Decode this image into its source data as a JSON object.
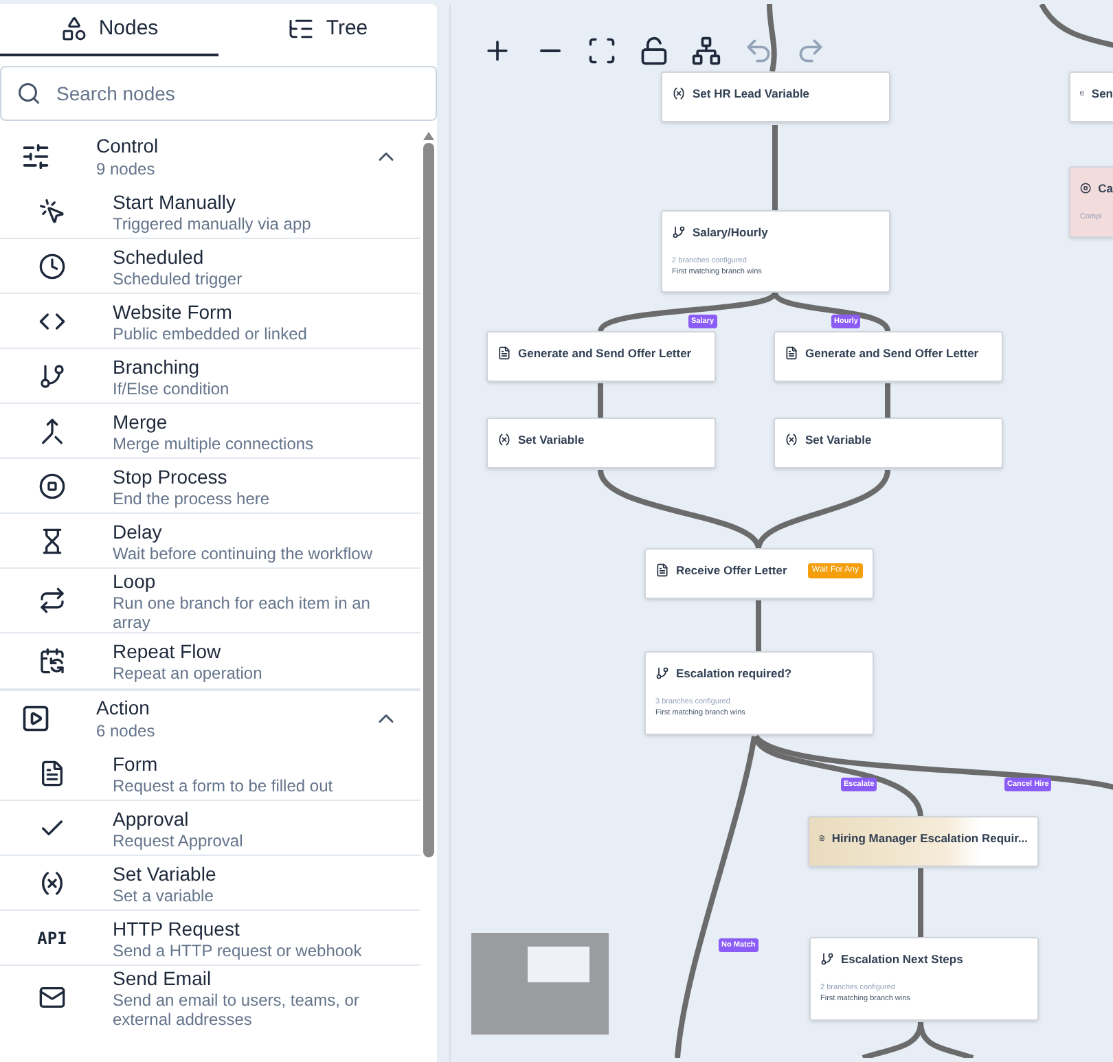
{
  "tabs": [
    {
      "label": "Nodes",
      "kind": "nodes",
      "selected": true
    },
    {
      "label": "Tree",
      "kind": "tree",
      "selected": false
    }
  ],
  "search": {
    "placeholder": "Search nodes"
  },
  "groups": [
    {
      "title": "Control",
      "kind": "control",
      "count": "9 nodes",
      "expanded": true,
      "items": [
        {
          "kind": "manual",
          "title": "Start Manually",
          "description": "Triggered manually via app"
        },
        {
          "kind": "schedule",
          "title": "Scheduled",
          "description": "Scheduled trigger"
        },
        {
          "kind": "webform",
          "title": "Website Form",
          "description": "Public embedded or linked"
        },
        {
          "kind": "branch",
          "title": "Branching",
          "description": "If/Else condition"
        },
        {
          "kind": "merge",
          "title": "Merge",
          "description": "Merge multiple connections"
        },
        {
          "kind": "stop",
          "title": "Stop Process",
          "description": "End the process here"
        },
        {
          "kind": "delay",
          "title": "Delay",
          "description": "Wait before continuing the workflow"
        },
        {
          "kind": "loop",
          "title": "Loop",
          "description": "Run one branch for each item in an array"
        },
        {
          "kind": "repeat",
          "title": "Repeat Flow",
          "description": "Repeat an operation"
        }
      ]
    },
    {
      "title": "Action",
      "kind": "action",
      "count": "6 nodes",
      "expanded": true,
      "items": [
        {
          "kind": "form",
          "title": "Form",
          "description": "Request a form to be filled out"
        },
        {
          "kind": "approval",
          "title": "Approval",
          "description": "Request Approval"
        },
        {
          "kind": "variable",
          "title": "Set Variable",
          "description": "Set a variable"
        },
        {
          "kind": "http",
          "title": "HTTP Request",
          "description": "Send a HTTP request or webhook",
          "icon_label": "API"
        },
        {
          "kind": "email",
          "title": "Send Email",
          "description": "Send an email to users, teams, or external addresses"
        }
      ]
    }
  ],
  "toolbar": [
    {
      "kind": "zoom-in",
      "disabled": false
    },
    {
      "kind": "zoom-out",
      "disabled": false
    },
    {
      "kind": "fit",
      "disabled": false
    },
    {
      "kind": "lock",
      "disabled": false
    },
    {
      "kind": "layout",
      "disabled": false
    },
    {
      "kind": "undo",
      "disabled": true
    },
    {
      "kind": "redo",
      "disabled": true
    }
  ],
  "nodes": [
    {
      "kind": "variable",
      "title": "Set HR Lead Variable",
      "highlighted": false
    },
    {
      "kind": "email",
      "title": "Sen",
      "highlighted": false
    },
    {
      "kind": "stop",
      "title": "Ca",
      "lines": [
        "Compl"
      ],
      "highlighted": false
    },
    {
      "kind": "branch",
      "title": "Salary/Hourly",
      "lines": [
        "2 branches configured",
        "First matching branch wins"
      ],
      "highlighted": false
    },
    {
      "kind": "form",
      "title": "Generate and Send Offer Letter",
      "highlighted": false
    },
    {
      "kind": "form",
      "title": "Generate and Send Offer Letter",
      "highlighted": false
    },
    {
      "kind": "variable",
      "title": "Set Variable",
      "highlighted": false
    },
    {
      "kind": "variable",
      "title": "Set Variable",
      "highlighted": false
    },
    {
      "kind": "form",
      "title": "Receive Offer Letter",
      "badge": "Wait For Any",
      "highlighted": false
    },
    {
      "kind": "branch",
      "title": "Escalation required?",
      "lines": [
        "3 branches configured",
        "First matching branch wins"
      ],
      "highlighted": false
    },
    {
      "kind": "form",
      "title": "Hiring Manager Escalation Requir...",
      "highlighted": true
    },
    {
      "kind": "branch",
      "title": "Escalation Next Steps",
      "lines": [
        "2 branches configured",
        "First matching branch wins"
      ],
      "highlighted": false
    }
  ],
  "edge_labels": [
    "Salary",
    "Hourly",
    "Escalate",
    "Cancel Hire",
    "No Match"
  ]
}
